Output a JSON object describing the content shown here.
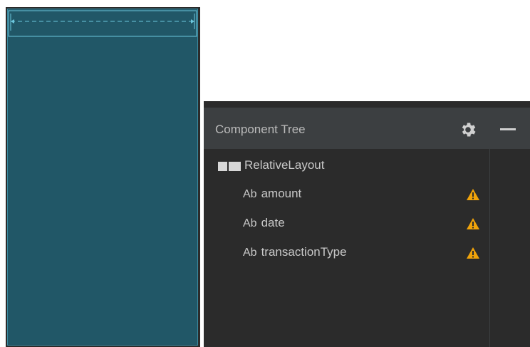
{
  "component_tree": {
    "title": "Component Tree",
    "root": {
      "label": "RelativeLayout",
      "icon": "relative-layout-icon"
    },
    "children": [
      {
        "prefix": "Ab",
        "label": "amount",
        "icon": "text-view-icon",
        "warning": true
      },
      {
        "prefix": "Ab",
        "label": "date",
        "icon": "text-view-icon",
        "warning": true
      },
      {
        "prefix": "Ab",
        "label": "transactionType",
        "icon": "text-view-icon",
        "warning": true
      }
    ],
    "gear_icon": "gear-icon",
    "minimize_icon": "minimize-icon"
  },
  "colors": {
    "blueprint_bg": "#215767",
    "blueprint_line": "#6cc7dd",
    "panel_bg": "#2b2b2b",
    "header_bg": "#3c3f41",
    "warning": "#f0a30a",
    "text": "#c8c8c8"
  }
}
